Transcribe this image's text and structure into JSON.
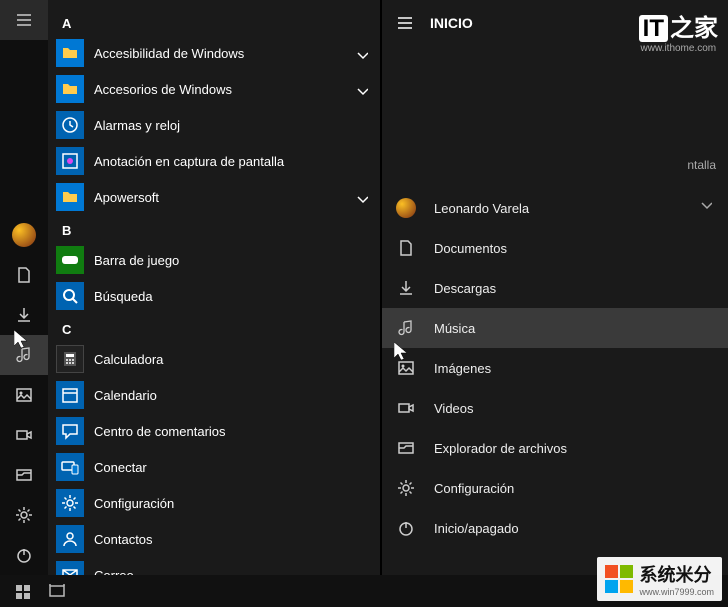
{
  "left_panel": {
    "sections": [
      {
        "letter": "A",
        "apps": [
          {
            "label": "Accesibilidad de Windows",
            "icon": "folder",
            "expandable": true
          },
          {
            "label": "Accesorios de Windows",
            "icon": "folder",
            "expandable": true
          },
          {
            "label": "Alarmas y reloj",
            "icon": "clock",
            "expandable": false
          },
          {
            "label": "Anotación en captura de pantalla",
            "icon": "snip",
            "expandable": false
          },
          {
            "label": "Apowersoft",
            "icon": "folder",
            "expandable": true
          }
        ]
      },
      {
        "letter": "B",
        "apps": [
          {
            "label": "Barra de juego",
            "icon": "gamebar",
            "expandable": false
          },
          {
            "label": "Búsqueda",
            "icon": "search",
            "expandable": false
          }
        ]
      },
      {
        "letter": "C",
        "apps": [
          {
            "label": "Calculadora",
            "icon": "calc",
            "expandable": false
          },
          {
            "label": "Calendario",
            "icon": "calendar",
            "expandable": false
          },
          {
            "label": "Centro de comentarios",
            "icon": "feedback",
            "expandable": false
          },
          {
            "label": "Conectar",
            "icon": "connect",
            "expandable": false
          },
          {
            "label": "Configuración",
            "icon": "settings",
            "expandable": false
          },
          {
            "label": "Contactos",
            "icon": "contacts",
            "expandable": false
          },
          {
            "label": "Correo",
            "icon": "mail",
            "expandable": false
          }
        ]
      }
    ],
    "rail_bottom": {
      "settings_label": "Configuración"
    }
  },
  "right_panel": {
    "header": "INICIO",
    "peek_text": "ntalla",
    "items": [
      {
        "label": "Leonardo Varela",
        "icon": "avatar"
      },
      {
        "label": "Documentos",
        "icon": "document"
      },
      {
        "label": "Descargas",
        "icon": "download"
      },
      {
        "label": "Música",
        "icon": "music",
        "highlighted": true
      },
      {
        "label": "Imágenes",
        "icon": "images"
      },
      {
        "label": "Videos",
        "icon": "videos"
      },
      {
        "label": "Explorador de archivos",
        "icon": "explorer"
      },
      {
        "label": "Configuración",
        "icon": "settings"
      },
      {
        "label": "Inicio/apagado",
        "icon": "power"
      }
    ]
  },
  "watermarks": {
    "top_logo_prefix": "IT",
    "top_logo_suffix": "之家",
    "top_sub": "www.ithome.com",
    "bottom_main": "系统米分",
    "bottom_sub": "www.win7999.com"
  }
}
